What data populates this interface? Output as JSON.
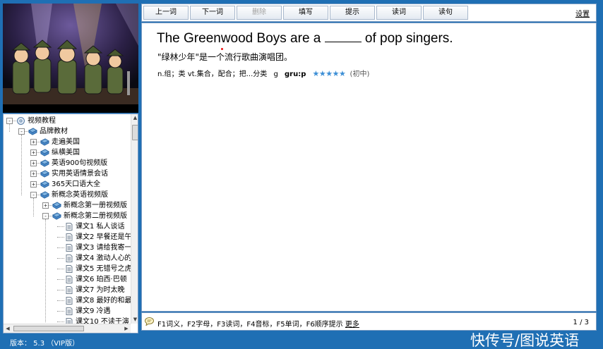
{
  "toolbar": {
    "buttons": [
      "上一词",
      "下一词",
      "删除",
      "填写",
      "提示",
      "读词",
      "读句"
    ],
    "settings": "设置"
  },
  "tree": {
    "nodes": [
      {
        "label": "视频教程",
        "level": 0,
        "toggle": "-"
      },
      {
        "label": "品牌教材",
        "level": 1,
        "toggle": "-"
      },
      {
        "label": "走遍美国",
        "level": 2,
        "toggle": "+"
      },
      {
        "label": "纵横美国",
        "level": 2,
        "toggle": "+"
      },
      {
        "label": "英语900句视频版",
        "level": 2,
        "toggle": "+"
      },
      {
        "label": "实用英语情景会话",
        "level": 2,
        "toggle": "+"
      },
      {
        "label": "365天口语大全",
        "level": 2,
        "toggle": "+"
      },
      {
        "label": "新概念英语视频版",
        "level": 2,
        "toggle": "-"
      },
      {
        "label": "新概念第一册视频版",
        "level": 3,
        "toggle": "+"
      },
      {
        "label": "新概念第二册视频版",
        "level": 3,
        "toggle": "-"
      },
      {
        "label": "课文1 私人谈话",
        "level": 4,
        "toggle": ""
      },
      {
        "label": "课文2 早餐还是午",
        "level": 4,
        "toggle": ""
      },
      {
        "label": "课文3 请给我寄一",
        "level": 4,
        "toggle": ""
      },
      {
        "label": "课文4 激动人心的",
        "level": 4,
        "toggle": ""
      },
      {
        "label": "课文5 无错号之虎",
        "level": 4,
        "toggle": ""
      },
      {
        "label": "课文6 珀西·巴顿",
        "level": 4,
        "toggle": ""
      },
      {
        "label": "课文7 为时太晚",
        "level": 4,
        "toggle": ""
      },
      {
        "label": "课文8 最好的和最",
        "level": 4,
        "toggle": ""
      },
      {
        "label": "课文9 冷遇",
        "level": 4,
        "toggle": ""
      },
      {
        "label": "课文10 不读于演",
        "level": 4,
        "toggle": ""
      }
    ]
  },
  "content": {
    "sentence_before": "The Greenwood Boys are a",
    "sentence_after": "of pop singers.",
    "translation": "\"绿林少年\"是一个流行歌曲演唱团。",
    "definition": "n.组；类 vt.集合，配合；把...分类",
    "first_letter": "g",
    "phonetic": "gru:p",
    "stars": "★★★★★",
    "level": "(初中)"
  },
  "hint": {
    "text": "F1词义，F2字母，F3读词，F4音标，F5单词，F6顺序提示",
    "more": "更多",
    "pager": "1 / 3"
  },
  "status": {
    "version": "版本：  5.3     （VIP版）"
  },
  "watermark": "快传号/图说英语",
  "colors": {
    "frame": "#1f6fb4",
    "border": "#7a9cc3",
    "star": "#3d8fd6"
  }
}
